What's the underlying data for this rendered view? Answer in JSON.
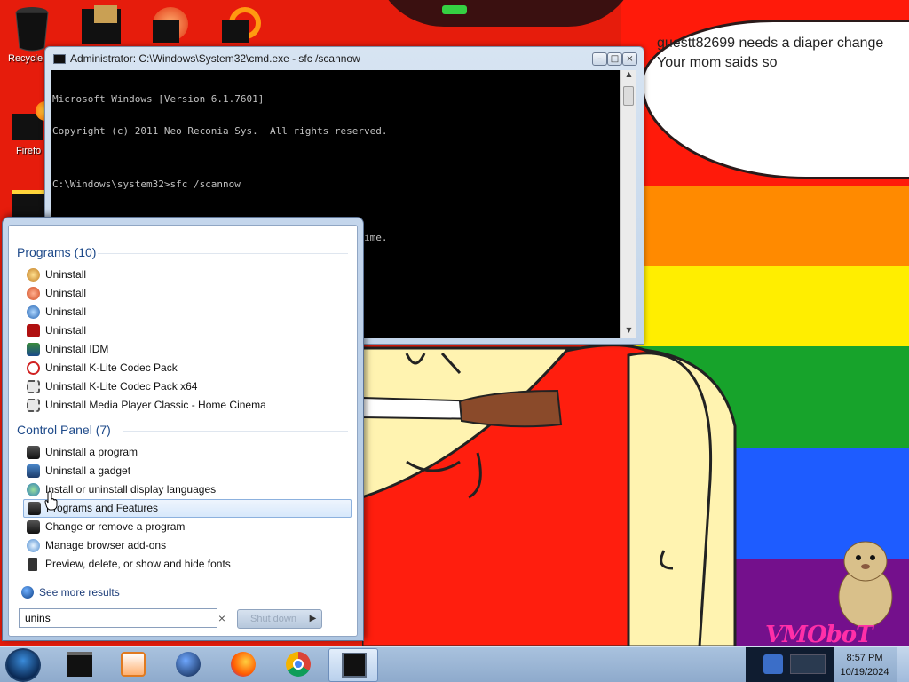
{
  "desktop": {
    "icons": [
      {
        "label": "Recycle"
      },
      {
        "label": "Firefo"
      }
    ],
    "bubble": {
      "line1": "guestt82699 needs a diaper change",
      "line2": "Your mom saids so"
    },
    "logo_text": "VMOboT"
  },
  "cmd_window": {
    "title": "Administrator: C:\\Windows\\System32\\cmd.exe - sfc  /scannow",
    "lines": [
      "Microsoft Windows [Version 6.1.7601]",
      "Copyright (c) 2011 Neo Reconia Sys.  All rights reserved.",
      "",
      "C:\\Windows\\system32>sfc /scannow",
      "",
      "Beginning system scan.  This process will take some time.",
      "",
      "Beginning verification phase of system scan.",
      "Verification 63% complete."
    ]
  },
  "start_menu": {
    "programs_header": "Programs (10)",
    "programs": [
      {
        "label": "Uninstall",
        "icon": "setup-globe-icon"
      },
      {
        "label": "Uninstall",
        "icon": "setup-orange-icon"
      },
      {
        "label": "Uninstall",
        "icon": "setup-blue-icon"
      },
      {
        "label": "Uninstall",
        "icon": "filezilla-icon"
      },
      {
        "label": "Uninstall IDM",
        "icon": "idm-icon"
      },
      {
        "label": "Uninstall K-Lite Codec Pack",
        "icon": "no-entry-icon"
      },
      {
        "label": "Uninstall K-Lite Codec Pack x64",
        "icon": "film-icon"
      },
      {
        "label": "Uninstall Media Player Classic - Home Cinema",
        "icon": "film-icon"
      }
    ],
    "control_panel_header": "Control Panel (7)",
    "control_panel": [
      {
        "label": "Uninstall a program",
        "icon": "programs-icon"
      },
      {
        "label": "Uninstall a gadget",
        "icon": "gadget-icon"
      },
      {
        "label": "Install or uninstall display languages",
        "icon": "language-icon"
      },
      {
        "label": "Programs and Features",
        "icon": "programs-icon"
      },
      {
        "label": "Change or remove a program",
        "icon": "programs-icon"
      },
      {
        "label": "Manage browser add-ons",
        "icon": "browser-icon"
      },
      {
        "label": "Preview, delete, or show and hide fonts",
        "icon": "fonts-icon"
      }
    ],
    "see_more": "See more results",
    "search_value": "unins",
    "shutdown_label": "Shut down"
  },
  "taskbar": {
    "clock_time": "8:57 PM",
    "clock_date": "10/19/2024"
  },
  "colors": {
    "accent": "#1e4a8a",
    "highlight": "#d7e8fb"
  }
}
